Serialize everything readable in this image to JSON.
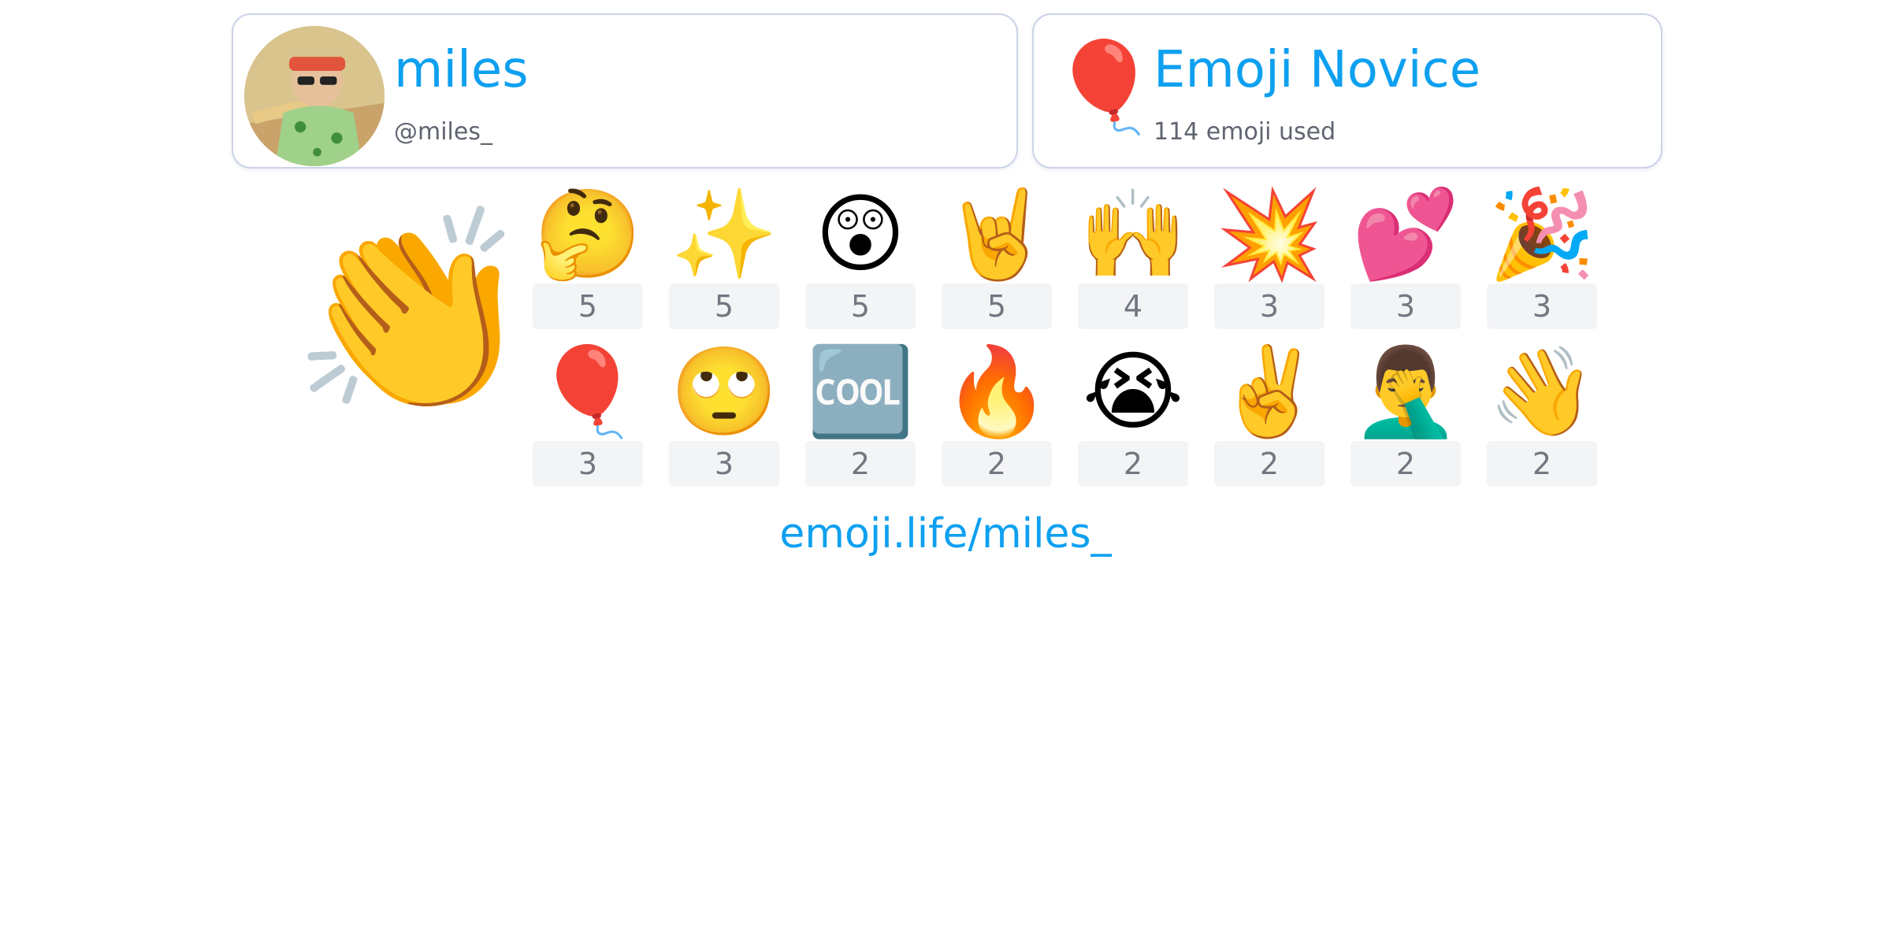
{
  "profile": {
    "username": "miles",
    "handle": "@miles_",
    "avatar_icon": "avatar-cartoon-man-icon"
  },
  "badge": {
    "emoji": "🎈",
    "title": "Emoji Novice",
    "subtitle": "114 emoji used"
  },
  "top_emoji": "👏",
  "emoji_stats": [
    {
      "emoji": "🤔",
      "count": "5"
    },
    {
      "emoji": "✨",
      "count": "5"
    },
    {
      "emoji": "😲",
      "count": "5"
    },
    {
      "emoji": "🤘",
      "count": "5"
    },
    {
      "emoji": "🙌",
      "count": "4"
    },
    {
      "emoji": "💥",
      "count": "3"
    },
    {
      "emoji": "💕",
      "count": "3"
    },
    {
      "emoji": "🎉",
      "count": "3"
    },
    {
      "emoji": "🎈",
      "count": "3"
    },
    {
      "emoji": "🙄",
      "count": "3"
    },
    {
      "emoji": "🆒",
      "count": "2"
    },
    {
      "emoji": "🔥",
      "count": "2"
    },
    {
      "emoji": "😭",
      "count": "2"
    },
    {
      "emoji": "✌️",
      "count": "2"
    },
    {
      "emoji": "🤦‍♂️",
      "count": "2"
    },
    {
      "emoji": "👋",
      "count": "2"
    }
  ],
  "footer": {
    "link": "emoji.life/miles_"
  },
  "colors": {
    "accent": "#0ea0f0",
    "card_border": "#cdd3e8",
    "count_bg": "#f3f4f6",
    "count_text": "#727780"
  }
}
